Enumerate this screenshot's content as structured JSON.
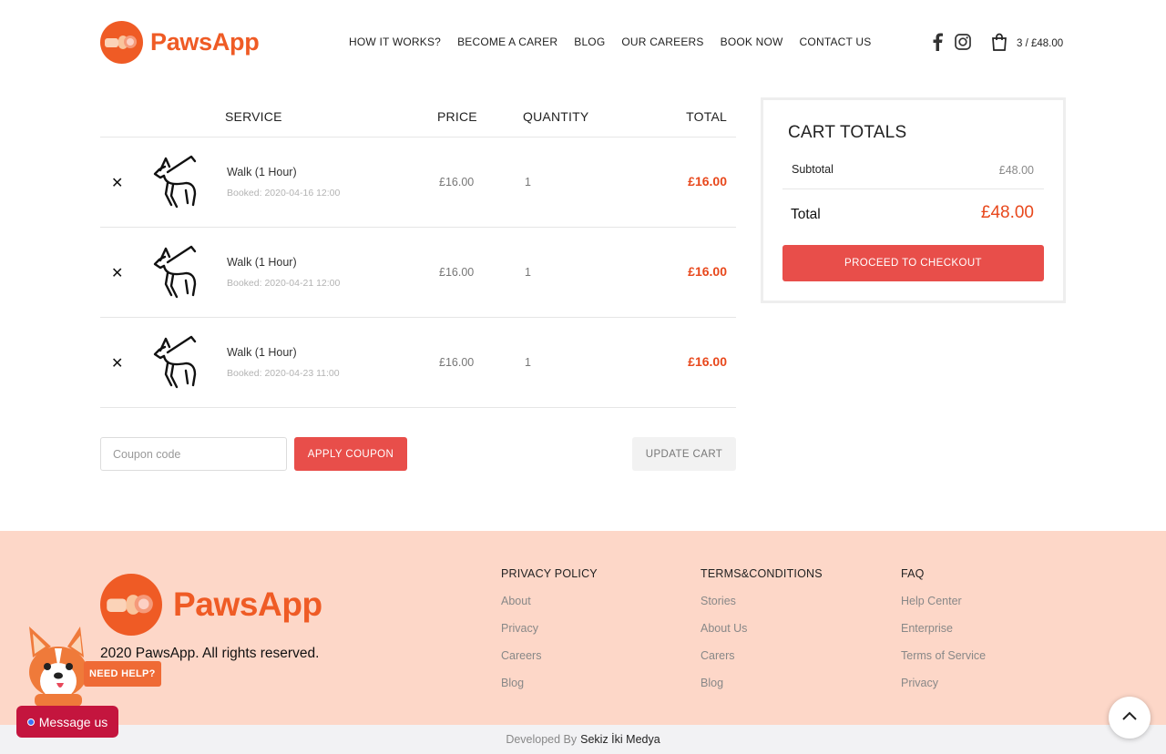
{
  "brand": {
    "name": "PawsApp",
    "accent": "#ef5b25",
    "price_color": "#e8481c",
    "button_color": "#e84e4a"
  },
  "nav": {
    "items": [
      "HOW IT WORKS?",
      "BECOME A CARER",
      "BLOG",
      "OUR CAREERS",
      "BOOK NOW",
      "CONTACT US"
    ]
  },
  "header_cart": {
    "summary": "3 / £48.00"
  },
  "icons": {
    "social": [
      "facebook-icon",
      "instagram-icon"
    ],
    "cart": "shopping-bag-icon"
  },
  "table": {
    "headers": {
      "service": "SERVICE",
      "price": "PRICE",
      "quantity": "QUANTITY",
      "total": "TOTAL"
    },
    "rows": [
      {
        "name": "Walk (1 Hour)",
        "booked": "Booked: 2020-04-16 12:00",
        "price": "£16.00",
        "qty": "1",
        "total": "£16.00"
      },
      {
        "name": "Walk (1 Hour)",
        "booked": "Booked: 2020-04-21 12:00",
        "price": "£16.00",
        "qty": "1",
        "total": "£16.00"
      },
      {
        "name": "Walk (1 Hour)",
        "booked": "Booked: 2020-04-23 11:00",
        "price": "£16.00",
        "qty": "1",
        "total": "£16.00"
      }
    ],
    "remove_symbol": "✕"
  },
  "coupon": {
    "placeholder": "Coupon code",
    "apply_label": "APPLY COUPON",
    "update_label": "UPDATE CART"
  },
  "totals": {
    "title": "CART TOTALS",
    "subtotal_label": "Subtotal",
    "subtotal_value": "£48.00",
    "total_label": "Total",
    "total_value": "£48.00",
    "checkout_label": "PROCEED TO CHECKOUT"
  },
  "footer": {
    "copyright": "2020 PawsApp. All rights reserved.",
    "columns": [
      {
        "title": "PRIVACY POLICY",
        "links": [
          "About",
          "Privacy",
          "Careers",
          "Blog"
        ]
      },
      {
        "title": "TERMS&CONDITIONS",
        "links": [
          "Stories",
          "About Us",
          "Carers",
          "Blog"
        ]
      },
      {
        "title": "FAQ",
        "links": [
          "Help Center",
          "Enterprise",
          "Terms of Service",
          "Privacy"
        ]
      }
    ],
    "developed_by": "Developed By",
    "developer": "Sekiz İki Medya"
  },
  "widgets": {
    "need_help": "NEED HELP?",
    "message": "Message us"
  }
}
